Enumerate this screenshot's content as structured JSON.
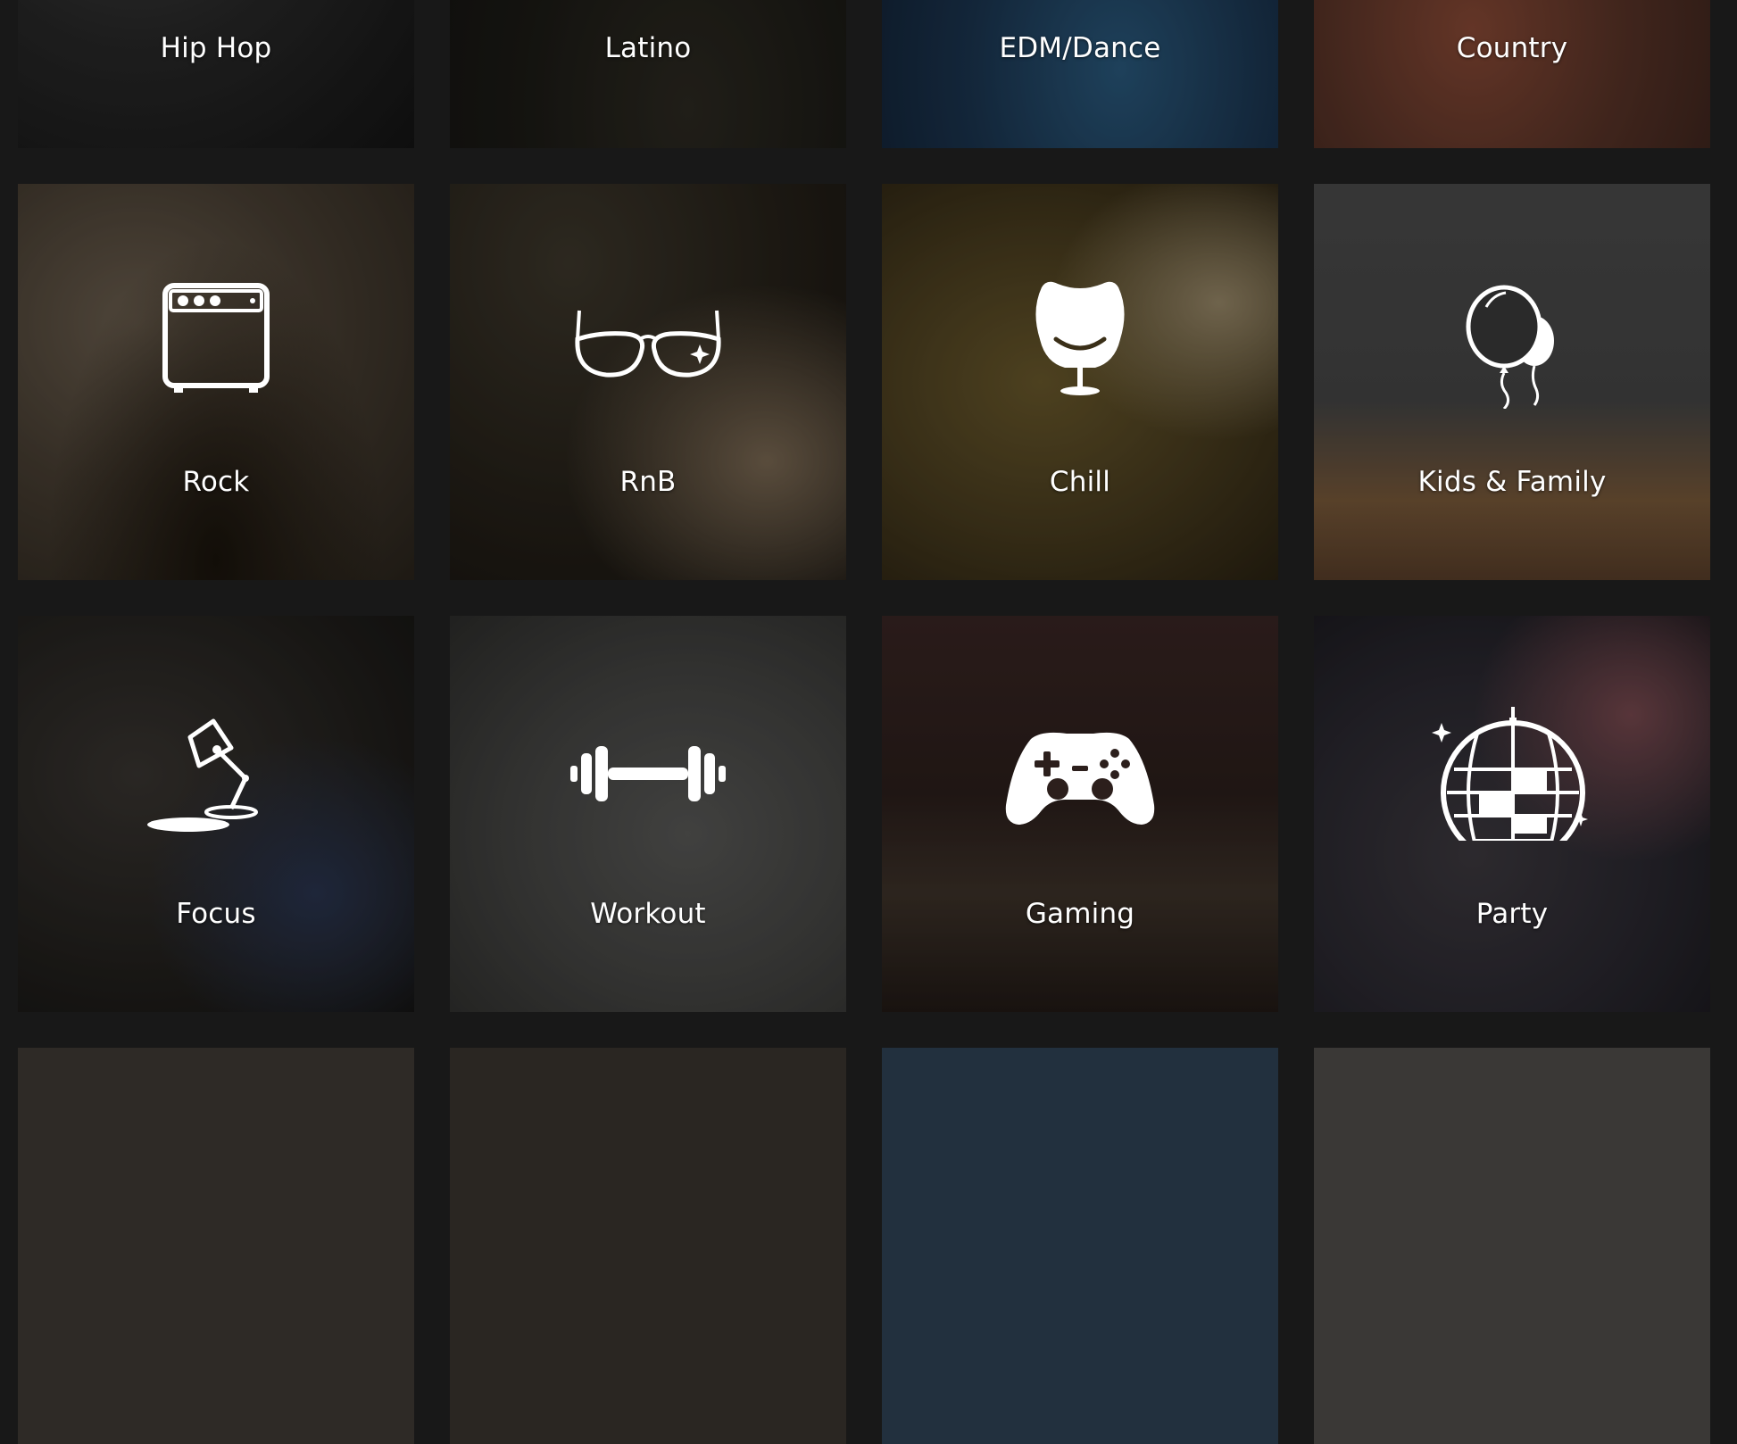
{
  "tiles": [
    {
      "label": "Hip Hop",
      "icon": "none"
    },
    {
      "label": "Latino",
      "icon": "none"
    },
    {
      "label": "EDM/Dance",
      "icon": "none"
    },
    {
      "label": "Country",
      "icon": "none"
    },
    {
      "label": "Rock",
      "icon": "amplifier-icon"
    },
    {
      "label": "RnB",
      "icon": "aviator-sunglasses-icon"
    },
    {
      "label": "Chill",
      "icon": "egg-chair-icon"
    },
    {
      "label": "Kids & Family",
      "icon": "balloons-icon"
    },
    {
      "label": "Focus",
      "icon": "desk-lamp-icon"
    },
    {
      "label": "Workout",
      "icon": "dumbbell-icon"
    },
    {
      "label": "Gaming",
      "icon": "game-controller-icon"
    },
    {
      "label": "Party",
      "icon": "disco-ball-icon"
    }
  ],
  "colors": {
    "page_background": "#181818",
    "label_text": "#ffffff"
  }
}
